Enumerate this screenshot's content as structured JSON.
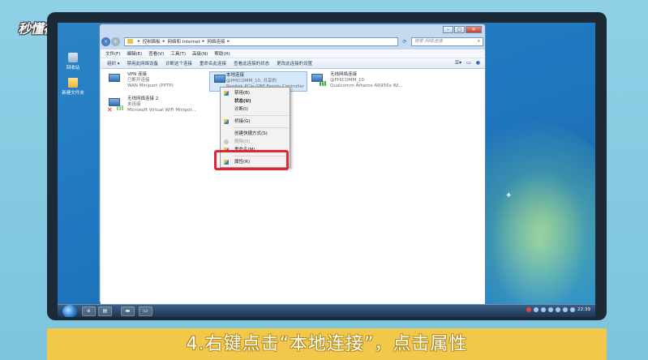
{
  "watermark": "秒懂视频",
  "desktop": {
    "icons": [
      {
        "label": "回收站"
      },
      {
        "label": "新建文件夹"
      }
    ]
  },
  "window": {
    "controls": {
      "minimize": "–",
      "maximize": "□",
      "close": "✕"
    },
    "address": {
      "crumbs": [
        "控制面板",
        "网络和 Internet",
        "网络连接"
      ],
      "search_placeholder": "搜索 网络连接"
    },
    "menu": [
      "文件(F)",
      "编辑(E)",
      "查看(V)",
      "工具(T)",
      "高级(N)",
      "帮助(H)"
    ],
    "toolbar": [
      "组织 ▾",
      "禁用此网络设备",
      "诊断这个连接",
      "重命名此连接",
      "查看此连接的状态",
      "更改此连接的设置"
    ],
    "connections": [
      {
        "name": "VPN 连接",
        "status": "已断开连接",
        "device": "WAN Miniport (PPTP)"
      },
      {
        "name": "本地连接",
        "status": "@PHICOMM_10, 共享的",
        "device": "Realtek PCIe GBE Family Controller"
      },
      {
        "name": "无线网络连接",
        "status": "@PHICOMM_10",
        "device": "Qualcomm Atheros AR956x Wi..."
      },
      {
        "name": "无线网络连接 2",
        "status": "未连接",
        "device": "Microsoft Virtual WiFi Minipor..."
      }
    ],
    "context_menu": {
      "items": [
        {
          "label": "禁用(B)"
        },
        {
          "label": "状态(U)"
        },
        {
          "label": "诊断(I)"
        },
        {
          "label": "桥接(G)"
        },
        {
          "label": "创建快捷方式(S)"
        },
        {
          "label": "删除(D)"
        },
        {
          "label": "重命名(M)"
        },
        {
          "label": "属性(R)"
        }
      ]
    }
  },
  "taskbar": {
    "clock": "22:39"
  },
  "caption": "4.右键点击“本地连接”，点击属性"
}
